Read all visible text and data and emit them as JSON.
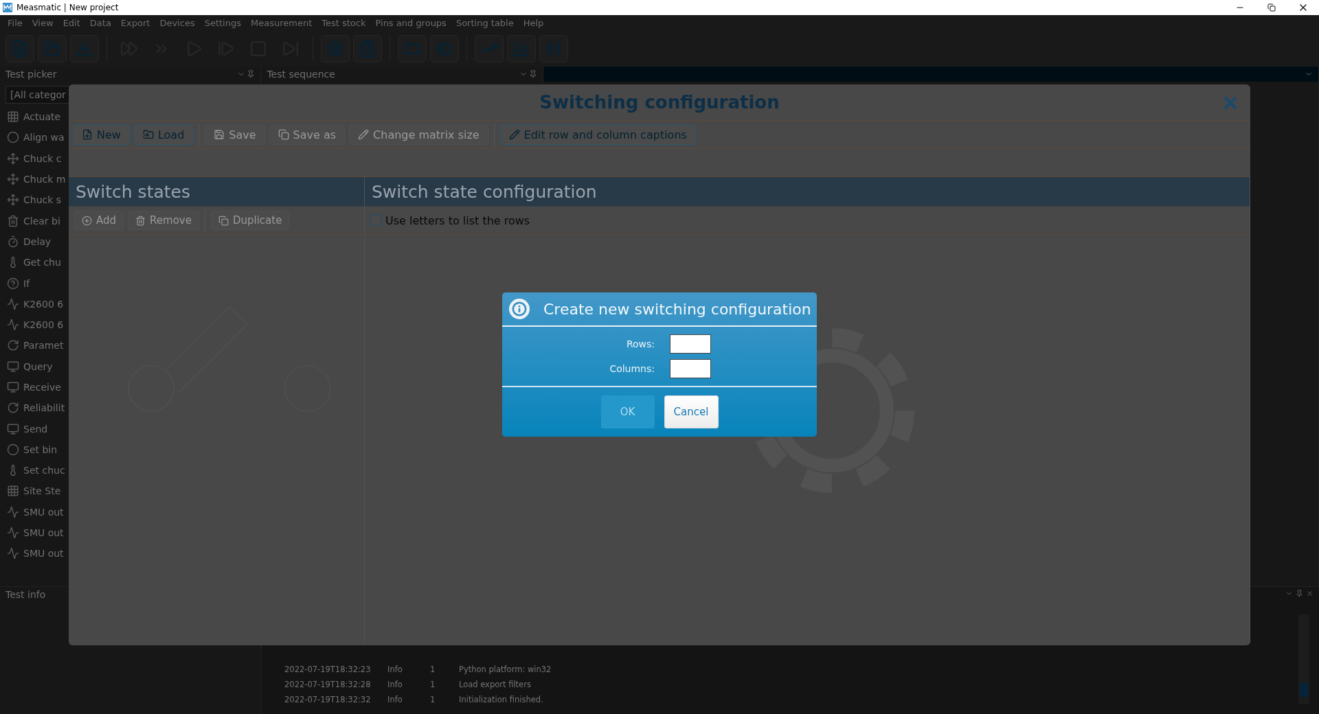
{
  "window": {
    "title": "Measmatic | New project"
  },
  "menu": [
    "File",
    "View",
    "Edit",
    "Data",
    "Export",
    "Devices",
    "Settings",
    "Measurement",
    "Test stock",
    "Pins and groups",
    "Sorting table",
    "Help"
  ],
  "toolbar": [
    {
      "disabled": false
    },
    {
      "disabled": false
    },
    {
      "disabled": false
    },
    {
      "disabled": true
    },
    {
      "disabled": true
    },
    {
      "disabled": true
    },
    {
      "disabled": true
    },
    {
      "disabled": true
    },
    {
      "disabled": true
    },
    {
      "disabled": false
    },
    {
      "disabled": false
    },
    {
      "disabled": false
    },
    {
      "disabled": false
    },
    {
      "disabled": false
    },
    {
      "disabled": false
    },
    {
      "disabled": false
    }
  ],
  "test_picker": {
    "title": "Test picker",
    "filter": "[All categor",
    "items": [
      "Actuate",
      "Align wa",
      "Chuck c",
      "Chuck m",
      "Chuck s",
      "Clear bi",
      "Delay",
      "Get chu",
      "If",
      "K2600 6",
      "K2600 6",
      "Paramet",
      "Query",
      "Receive",
      "Reliabilit",
      "Send",
      "Set bin",
      "Set chuc",
      "Site Ste",
      "SMU out",
      "SMU out",
      "SMU out"
    ]
  },
  "test_sequence": {
    "title": "Test sequence"
  },
  "test_info": {
    "title": "Test info"
  },
  "log": [
    {
      "time": "2022-07-19T18:32:23",
      "level": "Info",
      "id": "1",
      "message": "Python platform: win32"
    },
    {
      "time": "2022-07-19T18:32:28",
      "level": "Info",
      "id": "1",
      "message": "Load export filters"
    },
    {
      "time": "2022-07-19T18:32:32",
      "level": "Info",
      "id": "1",
      "message": "Initialization finished."
    }
  ],
  "switching": {
    "title": "Switching configuration",
    "toolbar": [
      {
        "label": "New",
        "disabled": false
      },
      {
        "label": "Load",
        "disabled": false
      },
      {
        "label": "Save",
        "disabled": true
      },
      {
        "label": "Save as",
        "disabled": true
      },
      {
        "label": "Change matrix size",
        "disabled": true
      },
      {
        "label": "Edit row and column captions",
        "disabled": false
      }
    ],
    "left_title": "Switch states",
    "right_title": "Switch state configuration",
    "list_toolbar": [
      {
        "label": "Add",
        "disabled": true
      },
      {
        "label": "Remove",
        "disabled": true
      },
      {
        "label": "Duplicate",
        "disabled": true
      }
    ],
    "checkbox": {
      "label": "Use letters to list the rows",
      "checked": false
    }
  },
  "prompt": {
    "title": "Create new switching configuration",
    "fields": [
      {
        "label": "Rows:"
      },
      {
        "label": "Columns:"
      }
    ],
    "buttons": [
      {
        "label": "OK",
        "disabled": true
      },
      {
        "label": "Cancel",
        "disabled": false
      }
    ]
  }
}
